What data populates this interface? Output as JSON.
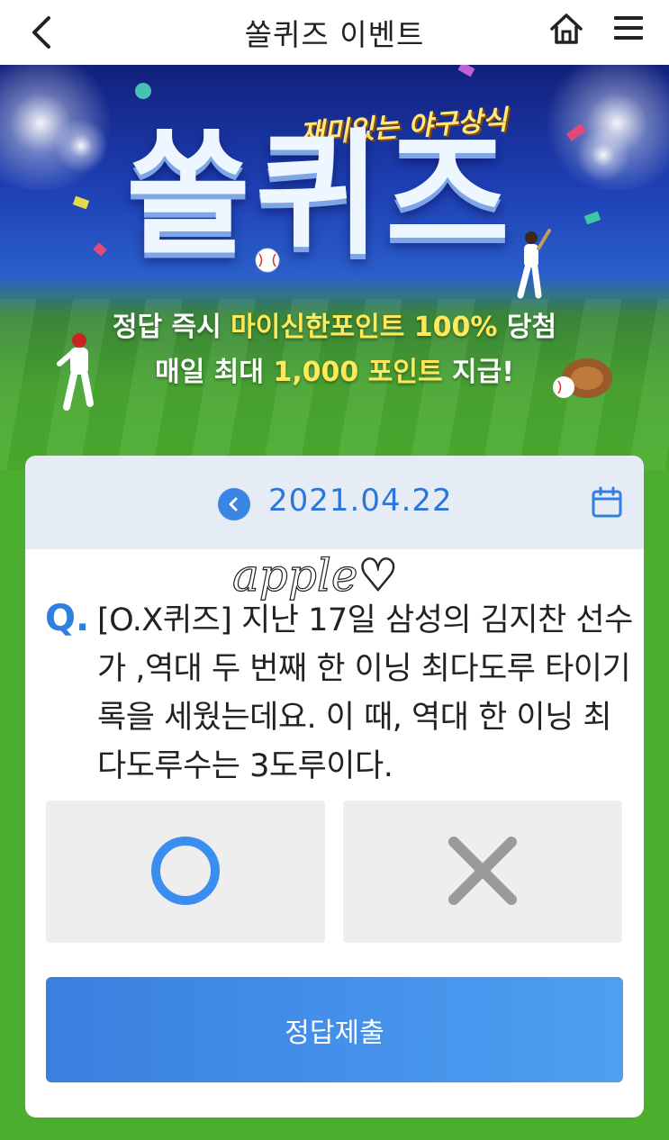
{
  "header": {
    "title": "쏠퀴즈 이벤트",
    "back_icon": "chevron-left-icon",
    "home_icon": "home-icon",
    "menu_icon": "hamburger-menu-icon"
  },
  "banner": {
    "subtitle": "재미있는 야구상식",
    "title": "쏠퀴즈",
    "promo_line1_prefix": "정답 즉시 ",
    "promo_line1_highlight": "마이신한포인트 100%",
    "promo_line1_suffix": " 당첨",
    "promo_line2_prefix": "매일 최대 ",
    "promo_line2_highlight": "1,000 포인트",
    "promo_line2_suffix": " 지급!"
  },
  "quiz": {
    "date": "2021.04.22",
    "prev_icon": "chevron-left-circle-icon",
    "calendar_icon": "calendar-icon",
    "watermark": "apple♡",
    "question_prefix": "Q.",
    "question_text": "[O.X퀴즈] 지난 17일 삼성의 김지찬 선수가 ,역대 두 번째 한 이닝 최다도루 타이기록을 세웠는데요. 이 때, 역대 한 이닝 최다도루수는 3도루이다.",
    "option_o_icon": "circle-o-icon",
    "option_x_icon": "cross-x-icon",
    "submit_label": "정답제출"
  },
  "colors": {
    "accent_blue": "#2f7fe0",
    "highlight_yellow": "#ffe95a",
    "field_green": "#4cae2e"
  }
}
